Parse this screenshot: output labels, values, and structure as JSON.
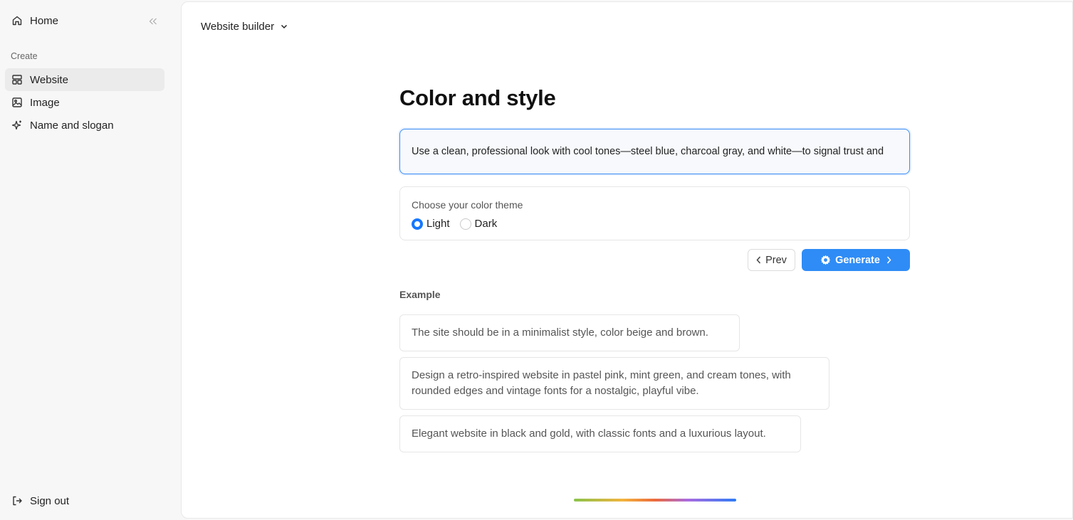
{
  "sidebar": {
    "home_label": "Home",
    "section_label": "Create",
    "items": [
      {
        "label": "Website",
        "icon": "layout-icon",
        "active": true
      },
      {
        "label": "Image",
        "icon": "image-icon",
        "active": false
      },
      {
        "label": "Name and slogan",
        "icon": "sparkle-icon",
        "active": false
      }
    ],
    "signout_label": "Sign out"
  },
  "header": {
    "builder_label": "Website builder"
  },
  "main": {
    "title": "Color and style",
    "prompt_value": "Use a clean, professional look with cool tones—steel blue, charcoal gray, and white—to signal trust and",
    "theme": {
      "label": "Choose your color theme",
      "options": [
        "Light",
        "Dark"
      ],
      "selected": "Light"
    },
    "prev_label": "Prev",
    "generate_label": "Generate",
    "example_label": "Example",
    "examples": [
      "The site should be in a minimalist style, color beige and brown.",
      "Design a retro-inspired website in pastel pink, mint green, and cream tones, with rounded edges and vintage fonts for a nostalgic, playful vibe.",
      "Elegant website in black and gold, with classic fonts and a luxurious layout."
    ]
  },
  "colors": {
    "accent": "#2f8cf6",
    "focus_border": "#3d8ef5",
    "sidebar_bg": "#f7f7f7"
  }
}
